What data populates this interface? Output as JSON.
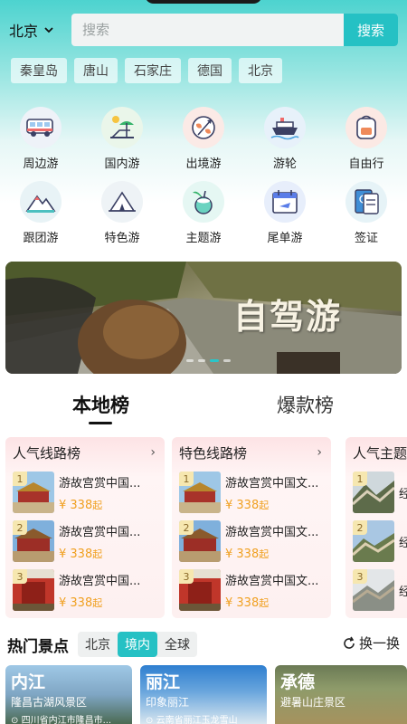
{
  "header": {
    "city": "北京",
    "search_placeholder": "搜索",
    "search_button": "搜索"
  },
  "quick_cities": [
    "秦皇岛",
    "唐山",
    "石家庄",
    "德国",
    "北京"
  ],
  "categories": [
    {
      "label": "周边游",
      "icon": "camper-van-icon"
    },
    {
      "label": "国内游",
      "icon": "beach-chair-icon"
    },
    {
      "label": "出境游",
      "icon": "globe-plane-icon"
    },
    {
      "label": "游轮",
      "icon": "cruise-ship-icon"
    },
    {
      "label": "自由行",
      "icon": "backpack-icon"
    },
    {
      "label": "跟团游",
      "icon": "mountain-icon"
    },
    {
      "label": "特色游",
      "icon": "tent-icon"
    },
    {
      "label": "主题游",
      "icon": "coconut-drink-icon"
    },
    {
      "label": "尾单游",
      "icon": "calendar-plane-icon"
    },
    {
      "label": "签证",
      "icon": "passport-icon"
    }
  ],
  "banner": {
    "title": "自驾游",
    "slide_count": 4,
    "active_slide": 2
  },
  "rank_tabs": {
    "tab1": "本地榜",
    "tab2": "爆款榜",
    "active": "本地榜"
  },
  "rank_cards": [
    {
      "title": "人气线路榜",
      "items": [
        {
          "rank": "1",
          "title": "游故宫赏中国...",
          "price": "¥ 338",
          "unit": "起"
        },
        {
          "rank": "2",
          "title": "游故宫赏中国...",
          "price": "¥ 338",
          "unit": "起"
        },
        {
          "rank": "3",
          "title": "游故宫赏中国...",
          "price": "¥ 338",
          "unit": "起"
        }
      ]
    },
    {
      "title": "特色线路榜",
      "items": [
        {
          "rank": "1",
          "title": "游故宫赏中国文...",
          "price": "¥ 338",
          "unit": "起"
        },
        {
          "rank": "2",
          "title": "游故宫赏中国文...",
          "price": "¥ 338",
          "unit": "起"
        },
        {
          "rank": "3",
          "title": "游故宫赏中国文...",
          "price": "¥ 338",
          "unit": "起"
        }
      ]
    },
    {
      "title": "人气主题",
      "items": [
        {
          "rank": "1",
          "title": "经",
          "price": "",
          "unit": ""
        },
        {
          "rank": "2",
          "title": "经",
          "price": "",
          "unit": ""
        },
        {
          "rank": "3",
          "title": "经",
          "price": "",
          "unit": ""
        }
      ]
    }
  ],
  "hot_spots": {
    "title": "热门景点",
    "filters": [
      "北京",
      "境内",
      "全球"
    ],
    "active_filter": "境内",
    "refresh_label": "换一换",
    "items": [
      {
        "name": "内江",
        "sub": "隆昌古湖风景区",
        "addr": "四川省内江市隆昌市..."
      },
      {
        "name": "丽江",
        "sub": "印象丽江",
        "addr": "云南省丽江玉龙雪山"
      },
      {
        "name": "承德",
        "sub": "避暑山庄景区",
        "addr": ""
      }
    ]
  }
}
